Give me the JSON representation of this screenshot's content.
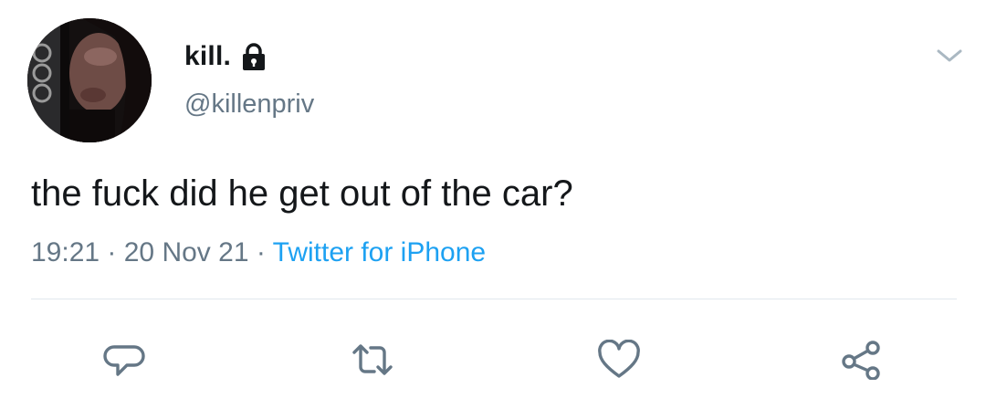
{
  "tweet": {
    "author": {
      "display_name": "kill.",
      "handle": "@killenpriv",
      "protected_icon": "lock-icon",
      "avatar_icon": "avatar"
    },
    "text": "the fuck did he get out of the car?",
    "time": "19:21",
    "date": "20 Nov 21",
    "separator": "·",
    "source": "Twitter for iPhone",
    "menu_icon": "chevron-down-icon"
  },
  "actions": [
    {
      "name": "reply",
      "icon": "reply-icon"
    },
    {
      "name": "retweet",
      "icon": "retweet-icon"
    },
    {
      "name": "like",
      "icon": "heart-icon"
    },
    {
      "name": "share",
      "icon": "share-icon"
    }
  ],
  "colors": {
    "text_primary": "#14171a",
    "text_secondary": "#657786",
    "link": "#1da1f2",
    "divider": "#e1e8ed"
  }
}
